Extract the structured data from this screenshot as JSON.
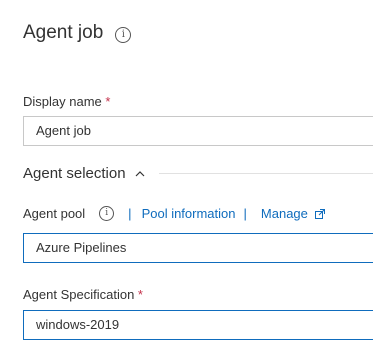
{
  "header": {
    "title": "Agent job"
  },
  "display_name": {
    "label": "Display name",
    "required_marker": "*",
    "value": "Agent job"
  },
  "agent_selection": {
    "title": "Agent selection",
    "expanded": true
  },
  "agent_pool": {
    "label": "Agent pool",
    "separator": "|",
    "pool_information_link": "Pool information",
    "manage_link": "Manage",
    "value": "Azure Pipelines"
  },
  "agent_specification": {
    "label": "Agent Specification",
    "required_marker": "*",
    "value": "windows-2019"
  },
  "icons": {
    "title_info": "info-icon",
    "pool_info": "info-icon",
    "section_toggle": "chevron-up-icon",
    "manage_external": "external-link-icon"
  },
  "colors": {
    "link": "#0f6cbd",
    "required": "#c4314b",
    "focused_border": "#0f6cbd",
    "input_border": "#c8c8c8"
  }
}
